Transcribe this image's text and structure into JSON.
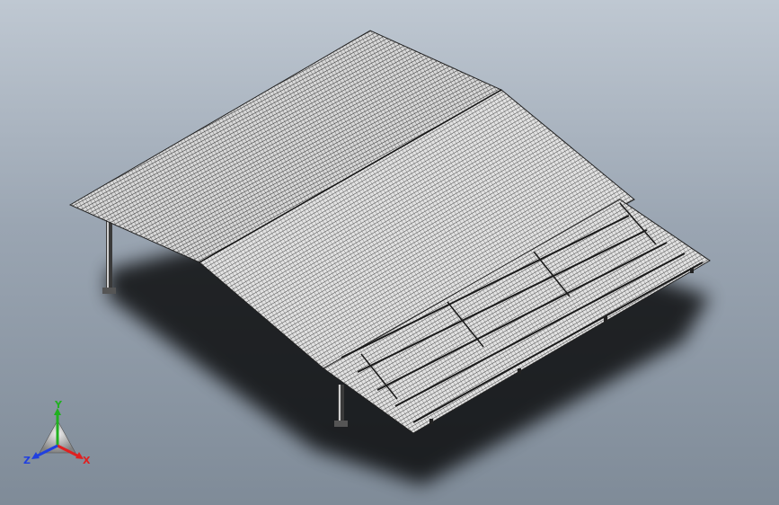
{
  "app": {
    "title": ""
  },
  "viewport": {
    "background_top": "#bfc8d2",
    "background_bottom": "#7f8b98",
    "model": "carport-solar-roof",
    "render_mode": "shaded-with-edges"
  },
  "triad": {
    "labels": {
      "x": "X",
      "y": "Y",
      "z": "Z"
    },
    "colors": {
      "x": "#e02020",
      "y": "#20b020",
      "z": "#2040e0"
    },
    "icon": "coordinate-triad-icon"
  }
}
